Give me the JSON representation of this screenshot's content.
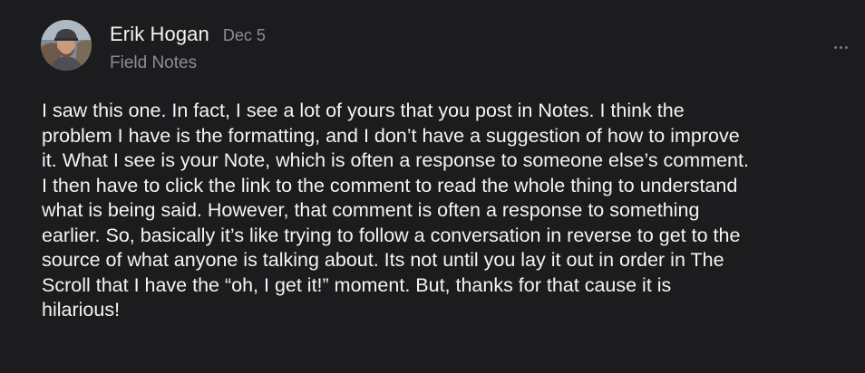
{
  "note": {
    "author": {
      "name": "Erik Hogan",
      "avatar_alt": "profile photo"
    },
    "date": "Dec 5",
    "publication": "Field Notes",
    "more_icon": "ellipsis-icon",
    "body": "I saw this one. In fact, I see a lot of yours that you post in Notes. I think the\nproblem I have is the formatting, and I don’t have a suggestion of how to improve\nit. What I see is your Note, which is often a response to someone else’s comment.\nI then have to click the link to the comment to read the whole thing to understand\nwhat is being said. However, that comment is often a response to something\nearlier. So, basically it’s like trying to follow a conversation in reverse to get to the\nsource of what anyone is talking about. Its not until you lay it out in order in The\nScroll that I have the “oh, I get it!” moment. But, thanks for that cause it is\nhilarious!"
  },
  "colors": {
    "background": "#1c1b1e",
    "primary_text": "#f4f4f4",
    "secondary_text": "#8e8d91"
  }
}
